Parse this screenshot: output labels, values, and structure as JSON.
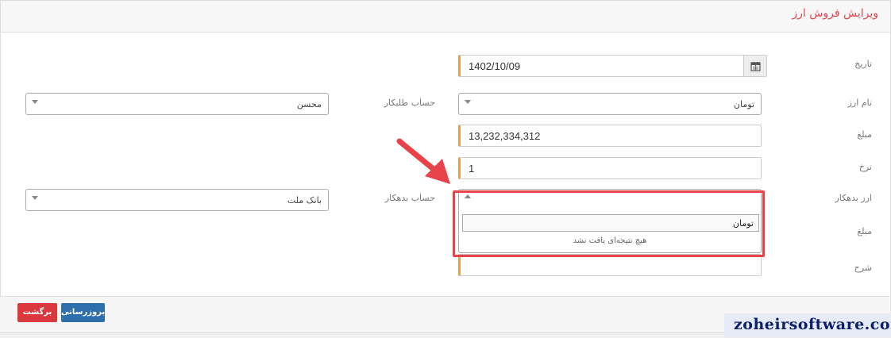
{
  "page_title": "ویرایش فروش ارز",
  "fields": {
    "date": {
      "label": "تاریخ",
      "value": "1402/10/09"
    },
    "currency_name": {
      "label": "نام ارز",
      "value": "تومان"
    },
    "creditor_account": {
      "label": "حساب طلبکار",
      "value": "محسن"
    },
    "amount": {
      "label": "مبلغ",
      "value": "13,232,334,312"
    },
    "rate": {
      "label": "نرخ",
      "value": "1"
    },
    "debtor_currency": {
      "label": "ارز بدهکار",
      "value": ""
    },
    "debtor_account": {
      "label": "حساب بدهکار",
      "value": "بانک ملت"
    },
    "amount2": {
      "label": "مبلغ"
    },
    "description": {
      "label": "شرح",
      "value": ""
    }
  },
  "dropdown": {
    "search_value": "تومان",
    "no_results": "هیچ نتیجه‌ای یافت نشد"
  },
  "buttons": {
    "update": "بروزرسانی",
    "back": "برگشت"
  },
  "watermark": "zoheirsoftware.com",
  "colors": {
    "title": "#e0474c",
    "input_accent": "#f0a04b",
    "highlight": "#e8434a",
    "back_button": "#d9383f",
    "update_button": "#2f6fad",
    "watermark_text": "#0b1f6e"
  },
  "icons": [
    "calendar-icon",
    "chevron-down-icon",
    "chevron-up-icon",
    "arrow-annotation-icon"
  ]
}
